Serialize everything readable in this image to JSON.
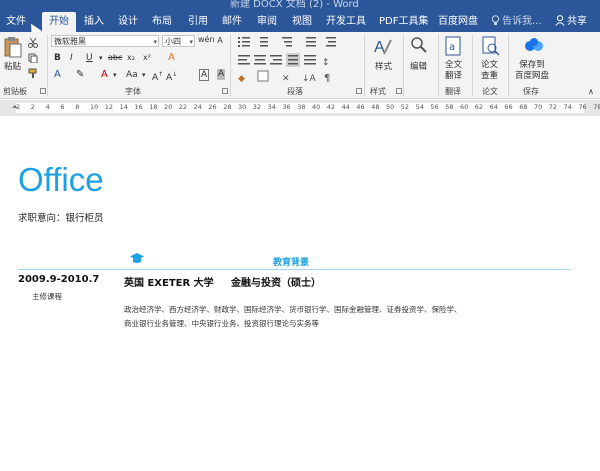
{
  "window": {
    "title": "新建 DOCX 文档 (2) - Word"
  },
  "tabs": [
    {
      "label": "文件"
    },
    {
      "label": "开始"
    },
    {
      "label": "插入"
    },
    {
      "label": "设计"
    },
    {
      "label": "布局"
    },
    {
      "label": "引用"
    },
    {
      "label": "邮件"
    },
    {
      "label": "审阅"
    },
    {
      "label": "视图"
    },
    {
      "label": "开发工具"
    },
    {
      "label": "PDF工具集"
    },
    {
      "label": "百度网盘"
    }
  ],
  "tell_me": {
    "label": "告诉我..."
  },
  "share": {
    "label": "共享"
  },
  "ribbon": {
    "clipboard": {
      "paste": "粘贴",
      "group": "剪贴板"
    },
    "font": {
      "family": "微软雅黑",
      "size": "小四",
      "group": "字体"
    },
    "paragraph": {
      "group": "段落"
    },
    "styles": {
      "label": "样式",
      "group": "样式"
    },
    "editing": {
      "label": "编辑"
    },
    "translate": {
      "label1": "全文",
      "label2": "翻译",
      "group": "翻译"
    },
    "paper": {
      "label1": "论文",
      "label2": "查重",
      "group": "论文"
    },
    "save": {
      "label1": "保存到",
      "label2": "百度网盘",
      "group": "保存"
    }
  },
  "ruler": {
    "ticks": [
      "2",
      "2",
      "4",
      "6",
      "8",
      "10",
      "12",
      "14",
      "16",
      "18",
      "20",
      "22",
      "24",
      "26",
      "28",
      "30",
      "32",
      "34",
      "36",
      "38",
      "40",
      "42",
      "44",
      "46",
      "48",
      "50",
      "52",
      "54",
      "56",
      "58",
      "60",
      "62",
      "64",
      "66",
      "68",
      "70",
      "72",
      "74",
      "76",
      "78"
    ]
  },
  "document": {
    "title": "Office",
    "intent": "求职意向：银行柜员",
    "section_title": "教育背景",
    "education": {
      "date": "2009.9-2010.7",
      "school": "英国 EXETER 大学",
      "major": "金融与投资（硕士）",
      "sub": "主修课程",
      "courses": [
        "政治经济学、西方经济学、财政学、国际经济学、货币银行学、国际金融管理、证券投资学、保险学、",
        "商业银行业务管理、中央银行业务、投资银行理论与实务等"
      ]
    }
  },
  "colors": {
    "accent": "#2b579a",
    "office_blue": "#1ba1e2",
    "ribbon_bg": "#f3f3f3"
  }
}
